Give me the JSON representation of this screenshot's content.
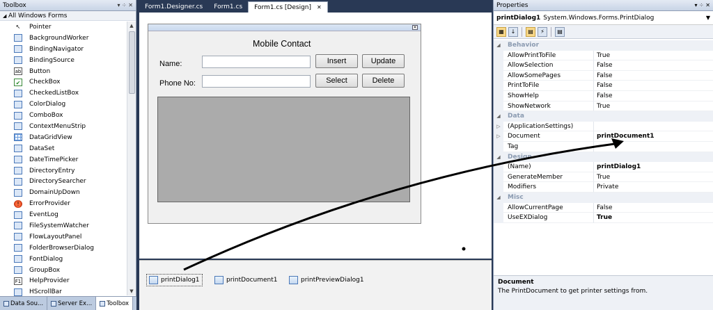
{
  "toolbox": {
    "title": "Toolbox",
    "pin": "▾ ⁘ ✕",
    "group": "All Windows Forms",
    "items": [
      {
        "label": "Pointer",
        "icon": "pointer-icon",
        "glyph": "↖",
        "cls": ""
      },
      {
        "label": "BackgroundWorker",
        "icon": "backgroundworker-icon",
        "glyph": "",
        "cls": "blue"
      },
      {
        "label": "BindingNavigator",
        "icon": "bindingnavigator-icon",
        "glyph": "",
        "cls": "blue"
      },
      {
        "label": "BindingSource",
        "icon": "bindingsource-icon",
        "glyph": "",
        "cls": "blue"
      },
      {
        "label": "Button",
        "icon": "button-icon",
        "glyph": "ab",
        "cls": "txt"
      },
      {
        "label": "CheckBox",
        "icon": "checkbox-icon",
        "glyph": "✔",
        "cls": "green"
      },
      {
        "label": "CheckedListBox",
        "icon": "checkedlistbox-icon",
        "glyph": "",
        "cls": "blue"
      },
      {
        "label": "ColorDialog",
        "icon": "colordialog-icon",
        "glyph": "",
        "cls": "blue"
      },
      {
        "label": "ComboBox",
        "icon": "combobox-icon",
        "glyph": "",
        "cls": "blue"
      },
      {
        "label": "ContextMenuStrip",
        "icon": "contextmenustrip-icon",
        "glyph": "",
        "cls": "blue"
      },
      {
        "label": "DataGridView",
        "icon": "datagridview-icon",
        "glyph": "",
        "cls": "grid"
      },
      {
        "label": "DataSet",
        "icon": "dataset-icon",
        "glyph": "",
        "cls": "blue"
      },
      {
        "label": "DateTimePicker",
        "icon": "datetimepicker-icon",
        "glyph": "",
        "cls": "blue"
      },
      {
        "label": "DirectoryEntry",
        "icon": "directoryentry-icon",
        "glyph": "",
        "cls": "blue"
      },
      {
        "label": "DirectorySearcher",
        "icon": "directorysearcher-icon",
        "glyph": "",
        "cls": "blue"
      },
      {
        "label": "DomainUpDown",
        "icon": "domainupdown-icon",
        "glyph": "",
        "cls": "blue"
      },
      {
        "label": "ErrorProvider",
        "icon": "errorprovider-icon",
        "glyph": "!",
        "cls": "red"
      },
      {
        "label": "EventLog",
        "icon": "eventlog-icon",
        "glyph": "",
        "cls": "blue"
      },
      {
        "label": "FileSystemWatcher",
        "icon": "filesystemwatcher-icon",
        "glyph": "",
        "cls": "blue"
      },
      {
        "label": "FlowLayoutPanel",
        "icon": "flowlayoutpanel-icon",
        "glyph": "",
        "cls": "blue"
      },
      {
        "label": "FolderBrowserDialog",
        "icon": "folderbrowserdialog-icon",
        "glyph": "",
        "cls": "blue"
      },
      {
        "label": "FontDialog",
        "icon": "fontdialog-icon",
        "glyph": "",
        "cls": "blue"
      },
      {
        "label": "GroupBox",
        "icon": "groupbox-icon",
        "glyph": "",
        "cls": "blue"
      },
      {
        "label": "HelpProvider",
        "icon": "helpprovider-icon",
        "glyph": "F1",
        "cls": "txt"
      },
      {
        "label": "HScrollBar",
        "icon": "hscrollbar-icon",
        "glyph": "",
        "cls": "blue"
      }
    ],
    "bottom_tabs": [
      {
        "label": "Data Sou...",
        "active": false
      },
      {
        "label": "Server Ex...",
        "active": false
      },
      {
        "label": "Toolbox",
        "active": true
      }
    ]
  },
  "editor": {
    "tabs": [
      {
        "label": "Form1.Designer.cs",
        "active": false
      },
      {
        "label": "Form1.cs",
        "active": false
      },
      {
        "label": "Form1.cs [Design]",
        "active": true
      }
    ],
    "close_glyph": "✕",
    "form": {
      "title": "Mobile Contact",
      "close_glyph": "✕",
      "name_label": "Name:",
      "phone_label": "Phone No:",
      "buttons": {
        "insert": "Insert",
        "update": "Update",
        "select": "Select",
        "delete": "Delete"
      }
    },
    "tray": [
      "printDialog1",
      "printDocument1",
      "printPreviewDialog1"
    ]
  },
  "properties": {
    "title": "Properties",
    "pin": "▾ ⁘ ✕",
    "object_name": "printDialog1",
    "object_type": "System.Windows.Forms.PrintDialog",
    "rows": [
      {
        "type": "cat",
        "name": "Behavior"
      },
      {
        "name": "AllowPrintToFile",
        "value": "True"
      },
      {
        "name": "AllowSelection",
        "value": "False"
      },
      {
        "name": "AllowSomePages",
        "value": "False"
      },
      {
        "name": "PrintToFile",
        "value": "False"
      },
      {
        "name": "ShowHelp",
        "value": "False"
      },
      {
        "name": "ShowNetwork",
        "value": "True"
      },
      {
        "type": "cat",
        "name": "Data"
      },
      {
        "name": "(ApplicationSettings)",
        "value": "",
        "expand": true
      },
      {
        "name": "Document",
        "value": "printDocument1",
        "bold": true,
        "expand": true
      },
      {
        "name": "Tag",
        "value": ""
      },
      {
        "type": "cat",
        "name": "Design"
      },
      {
        "name": "(Name)",
        "value": "printDialog1",
        "bold": true
      },
      {
        "name": "GenerateMember",
        "value": "True"
      },
      {
        "name": "Modifiers",
        "value": "Private"
      },
      {
        "type": "cat",
        "name": "Misc"
      },
      {
        "name": "AllowCurrentPage",
        "value": "False"
      },
      {
        "name": "UseEXDialog",
        "value": "True",
        "bold": true
      }
    ],
    "desc_title": "Document",
    "desc_text": "The PrintDocument to get printer settings from."
  }
}
